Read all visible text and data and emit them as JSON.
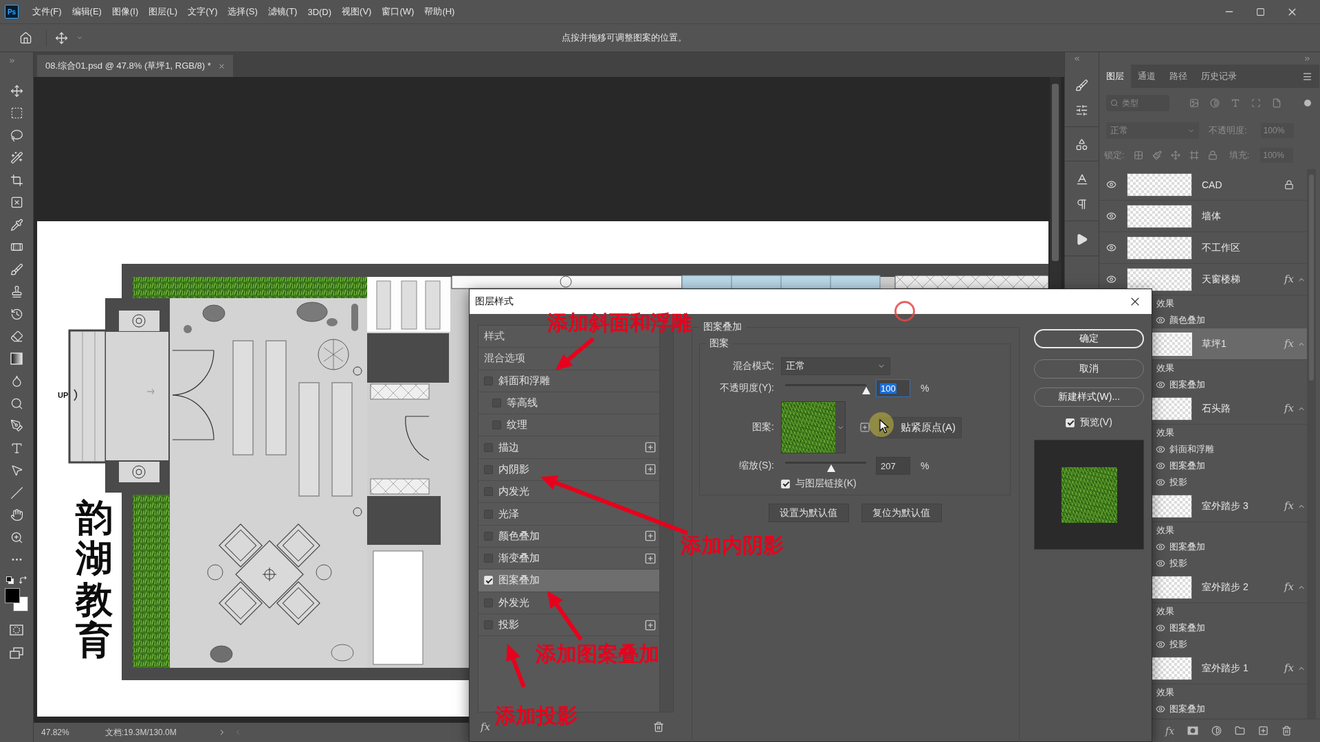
{
  "app": {
    "logo": "Ps"
  },
  "menu": [
    "文件(F)",
    "编辑(E)",
    "图像(I)",
    "图层(L)",
    "文字(Y)",
    "选择(S)",
    "滤镜(T)",
    "3D(D)",
    "视图(V)",
    "窗口(W)",
    "帮助(H)"
  ],
  "options_bar": {
    "hint": "点按并拖移可调整图案的位置。"
  },
  "document_tab": {
    "title": "08.综合01.psd @ 47.8% (草坪1, RGB/8) *"
  },
  "document": {
    "entrance_label": "UP",
    "title_text": "韵湖教育"
  },
  "status_bar": {
    "zoom": "47.82%",
    "doc_size": "文档:19.3M/130.0M"
  },
  "layers_panel": {
    "tabs": [
      {
        "label": "图层",
        "selected": true
      },
      {
        "label": "通道",
        "selected": false
      },
      {
        "label": "路径",
        "selected": false
      },
      {
        "label": "历史记录",
        "selected": false
      }
    ],
    "filter": {
      "placeholder": "类型"
    },
    "blend_mode": "正常",
    "opacity_label": "不透明度:",
    "opacity": "100%",
    "lock_label": "锁定:",
    "fill_label": "填充:",
    "fill": "100%",
    "layers": [
      {
        "name": "CAD",
        "visible": true,
        "locked": true,
        "selected": false
      },
      {
        "name": "墙体",
        "visible": true,
        "selected": false
      },
      {
        "name": "不工作区",
        "visible": true,
        "selected": false
      },
      {
        "name": "天窗楼梯",
        "visible": true,
        "selected": false,
        "fx": "fx",
        "expanded": true,
        "effects_label": "效果",
        "effects": [
          {
            "name": "颜色叠加",
            "visible": true
          }
        ]
      },
      {
        "name": "草坪1",
        "selected": true,
        "fx": "fx",
        "expanded": true,
        "effects_label": "效果",
        "effects": [
          {
            "name": "图案叠加",
            "visible": true
          }
        ]
      },
      {
        "name": "石头路",
        "selected": false,
        "fx": "fx",
        "expanded": true,
        "effects_label": "效果",
        "effects": [
          {
            "name": "斜面和浮雕",
            "visible": true
          },
          {
            "name": "图案叠加",
            "visible": true
          },
          {
            "name": "投影",
            "visible": true
          }
        ]
      },
      {
        "name": "室外踏步 3",
        "selected": false,
        "fx": "fx",
        "expanded": true,
        "effects_label": "效果",
        "effects": [
          {
            "name": "图案叠加",
            "visible": true
          },
          {
            "name": "投影",
            "visible": true
          }
        ]
      },
      {
        "name": "室外踏步 2",
        "selected": false,
        "fx": "fx",
        "expanded": true,
        "effects_label": "效果",
        "effects": [
          {
            "name": "图案叠加",
            "visible": true
          },
          {
            "name": "投影",
            "visible": true
          }
        ]
      },
      {
        "name": "室外踏步 1",
        "selected": false,
        "fx": "fx",
        "expanded": true,
        "effects_label": "效果",
        "effects": [
          {
            "name": "图案叠加",
            "visible": true
          }
        ]
      }
    ],
    "footer_fx": "fx"
  },
  "dialog": {
    "title": "图层样式",
    "styles": [
      {
        "label": "样式",
        "kind": "heading",
        "selected": false
      },
      {
        "label": "混合选项",
        "kind": "heading",
        "selected": false
      },
      {
        "label": "斜面和浮雕",
        "kind": "effect",
        "checked": false,
        "selected": false
      },
      {
        "label": "等高线",
        "kind": "sub",
        "checked": false,
        "selected": false
      },
      {
        "label": "纹理",
        "kind": "sub",
        "checked": false,
        "selected": false
      },
      {
        "label": "描边",
        "kind": "effect",
        "checked": false,
        "selected": false,
        "addable": true
      },
      {
        "label": "内阴影",
        "kind": "effect",
        "checked": false,
        "selected": false,
        "addable": true
      },
      {
        "label": "内发光",
        "kind": "effect",
        "checked": false,
        "selected": false
      },
      {
        "label": "光泽",
        "kind": "effect",
        "checked": false,
        "selected": false
      },
      {
        "label": "颜色叠加",
        "kind": "effect",
        "checked": false,
        "selected": false,
        "addable": true
      },
      {
        "label": "渐变叠加",
        "kind": "effect",
        "checked": false,
        "selected": false,
        "addable": true
      },
      {
        "label": "图案叠加",
        "kind": "effect",
        "checked": true,
        "selected": true
      },
      {
        "label": "外发光",
        "kind": "effect",
        "checked": false,
        "selected": false
      },
      {
        "label": "投影",
        "kind": "effect",
        "checked": false,
        "selected": false,
        "addable": true
      }
    ],
    "styles_fx": "fx",
    "section_title": "图案叠加",
    "group_title": "图案",
    "fields": [
      {
        "kind": "select",
        "label": "混合模式:",
        "value": "正常"
      },
      {
        "kind": "slider",
        "label": "不透明度(Y):",
        "level": 1,
        "value": "100",
        "unit": "%",
        "focused": true
      },
      {
        "kind": "pattern",
        "label": "图案:",
        "button": "贴紧原点(A)"
      },
      {
        "kind": "slider",
        "label": "缩放(S):",
        "level": 0.57,
        "value": "207",
        "unit": "%",
        "focused": false
      },
      {
        "kind": "checkbox",
        "label": "与图层链接(K)",
        "checked": true
      }
    ],
    "default_buttons": [
      {
        "label": "设置为默认值"
      },
      {
        "label": "复位为默认值"
      }
    ],
    "actions": [
      {
        "label": "确定",
        "default": true
      },
      {
        "label": "取消",
        "default": false
      },
      {
        "label": "新建样式(W)...",
        "default": false
      }
    ],
    "preview": {
      "label": "预览(V)",
      "checked": true
    }
  },
  "annotations": [
    {
      "text": "添加斜面和浮雕"
    },
    {
      "text": "添加内阴影"
    },
    {
      "text": "添加图案叠加"
    },
    {
      "text": "添加投影"
    }
  ]
}
